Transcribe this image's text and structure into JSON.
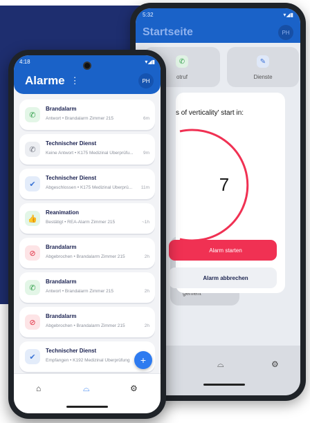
{
  "back": {
    "status_time": "5:32",
    "status_right": "▾◢▮",
    "title": "Startseite",
    "avatar": "PH",
    "tile_left_label": "otruf",
    "tile_right_label": "Dienste",
    "tile_bottom_label": "gement",
    "dialog_question": "s of verticality' start in:",
    "countdown": "7",
    "btn_start": "Alarm starten",
    "btn_cancel": "Alarm abbrechen"
  },
  "front": {
    "status_time": "4:18",
    "status_right": "▾◢▮",
    "title": "Alarme",
    "menu": "⋮",
    "avatar": "PH",
    "items": [
      {
        "title": "Brandalarm",
        "sub": "Antwort • Brandalarm Zimmer 215",
        "time": "6m",
        "icon": "phone-icon",
        "glyph": "✆",
        "color": "green"
      },
      {
        "title": "Technischer Dienst",
        "sub": "Keine Antwort • K175 Medizinal Überprüfu...",
        "time": "9m",
        "icon": "phone-missed-icon",
        "glyph": "✆",
        "color": "grey"
      },
      {
        "title": "Technischer Dienst",
        "sub": "Abgeschlossen • K175 Medizinal Überprü...",
        "time": "11m",
        "icon": "double-check-icon",
        "glyph": "✔",
        "color": "blue"
      },
      {
        "title": "Reanimation",
        "sub": "Bestätigt • REA-Alarm Zimmer 215",
        "time": "~1h",
        "icon": "thumbs-up-icon",
        "glyph": "👍",
        "color": "green"
      },
      {
        "title": "Brandalarm",
        "sub": "Abgebrochen • Brandalarm Zimmer 215",
        "time": "2h",
        "icon": "cancel-icon",
        "glyph": "⊘",
        "color": "red"
      },
      {
        "title": "Brandalarm",
        "sub": "Antwort • Brandalarm Zimmer 215",
        "time": "2h",
        "icon": "phone-icon",
        "glyph": "✆",
        "color": "green"
      },
      {
        "title": "Brandalarm",
        "sub": "Abgebrochen • Brandalarm Zimmer 215",
        "time": "2h",
        "icon": "cancel-icon",
        "glyph": "⊘",
        "color": "red"
      },
      {
        "title": "Technischer Dienst",
        "sub": "Empfangen • K192 Medizinal Überprüfung",
        "time": "",
        "icon": "double-check-icon",
        "glyph": "✔",
        "color": "blue"
      }
    ],
    "fab": "+",
    "nav_home": "⌂",
    "nav_inbox": "⌓",
    "nav_settings": "⚙"
  }
}
